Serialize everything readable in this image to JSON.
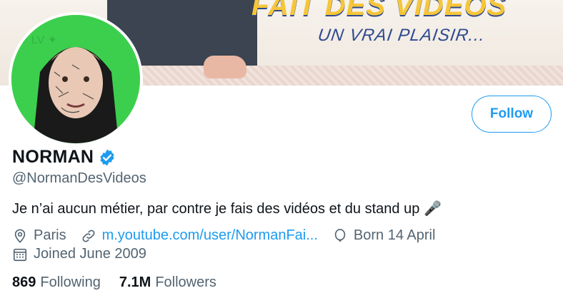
{
  "banner": {
    "headline": "FAIT DES VIDEOS",
    "tagline": "UN VRAI PLAISIR..."
  },
  "profile": {
    "name": "NORMAN",
    "handle": "@NormanDesVideos",
    "bio": "Je n’ai aucun métier, par contre je fais des vidéos et du stand up",
    "bio_emoji": "🎤",
    "location": "Paris",
    "website": "m.youtube.com/user/NormanFai...",
    "birthday": "Born 14 April",
    "joined": "Joined June 2009",
    "verified": true
  },
  "actions": {
    "follow_label": "Follow"
  },
  "stats": {
    "following_count": "869",
    "following_label": "Following",
    "followers_count": "7.1M",
    "followers_label": "Followers"
  },
  "colors": {
    "accent": "#1d9bf0",
    "text_primary": "#0f1419",
    "text_secondary": "#536471"
  }
}
